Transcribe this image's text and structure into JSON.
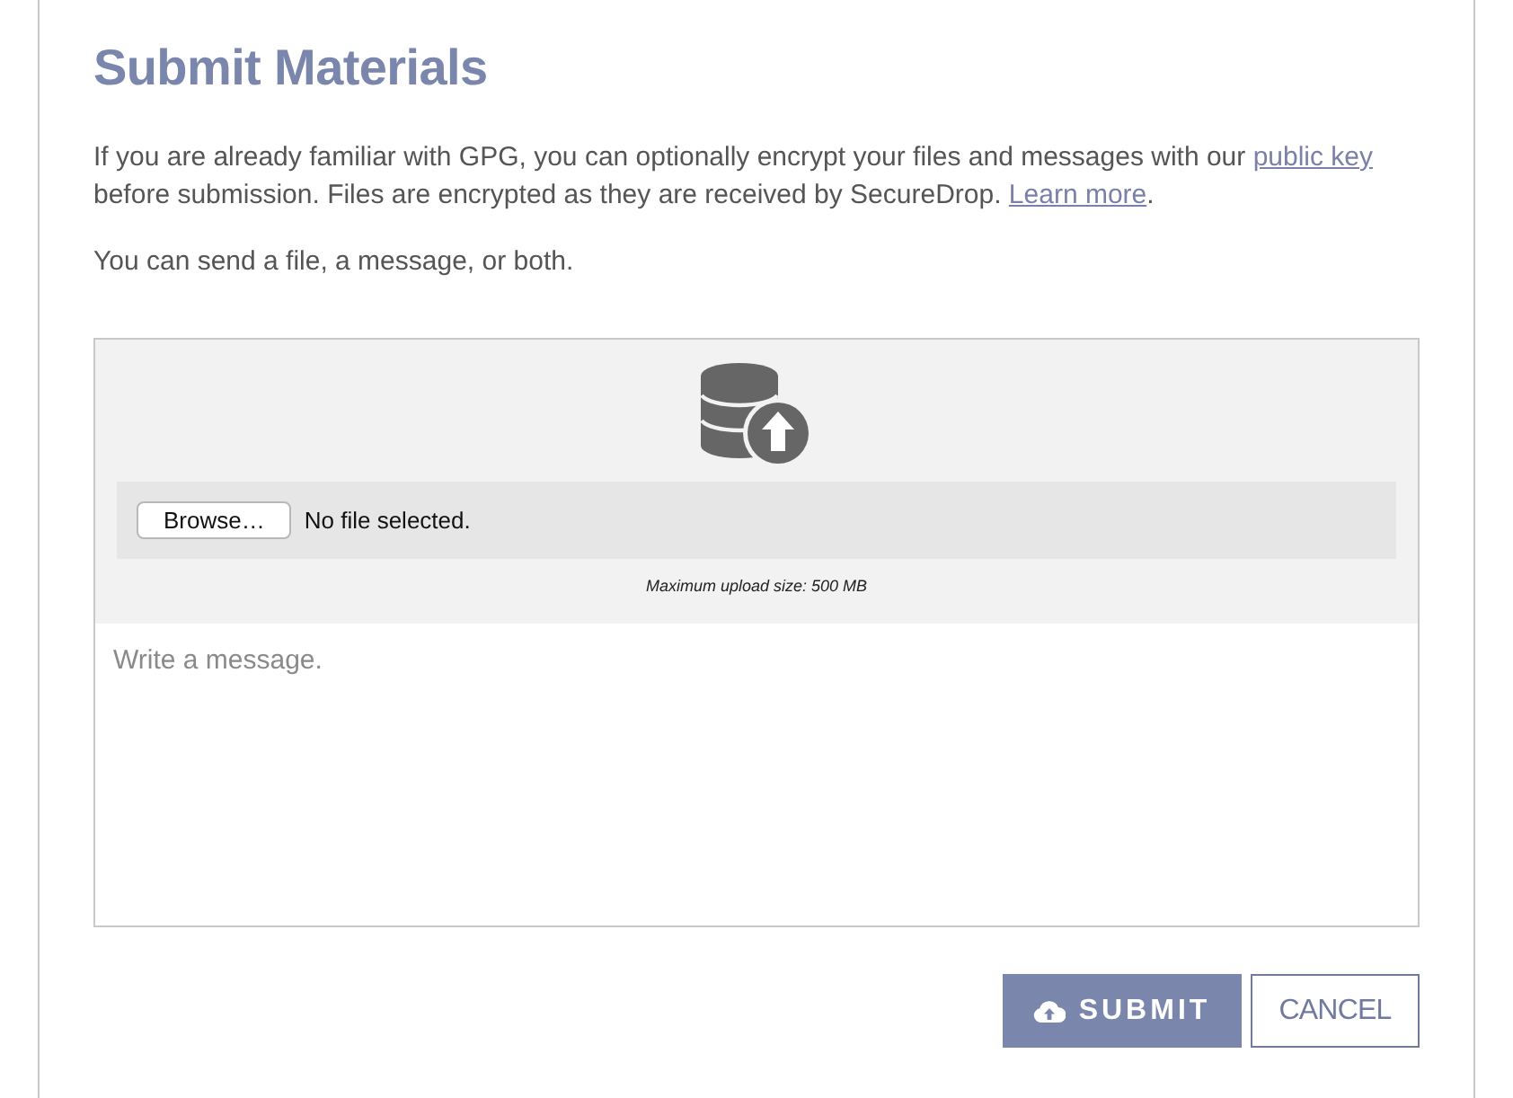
{
  "page": {
    "title": "Submit Materials"
  },
  "intro": [
    {
      "kind": "text",
      "text": "If you are already familiar with GPG, you can optionally encrypt your files and messages with our "
    },
    {
      "kind": "link",
      "text": "public key"
    },
    {
      "kind": "text",
      "text": " before submission. Files are encrypted as they are received by SecureDrop. "
    },
    {
      "kind": "link",
      "text": "Learn more"
    },
    {
      "kind": "text",
      "text": "."
    }
  ],
  "note": "You can send a file, a message, or both.",
  "upload": {
    "browse_button": "Browse…",
    "file_status": "No file selected.",
    "max_size": "Maximum upload size: 500 MB"
  },
  "message": {
    "placeholder": "Write a message."
  },
  "buttons": [
    {
      "kind": "primary",
      "label": "SUBMIT"
    },
    {
      "kind": "secondary",
      "label": "CANCEL"
    }
  ]
}
